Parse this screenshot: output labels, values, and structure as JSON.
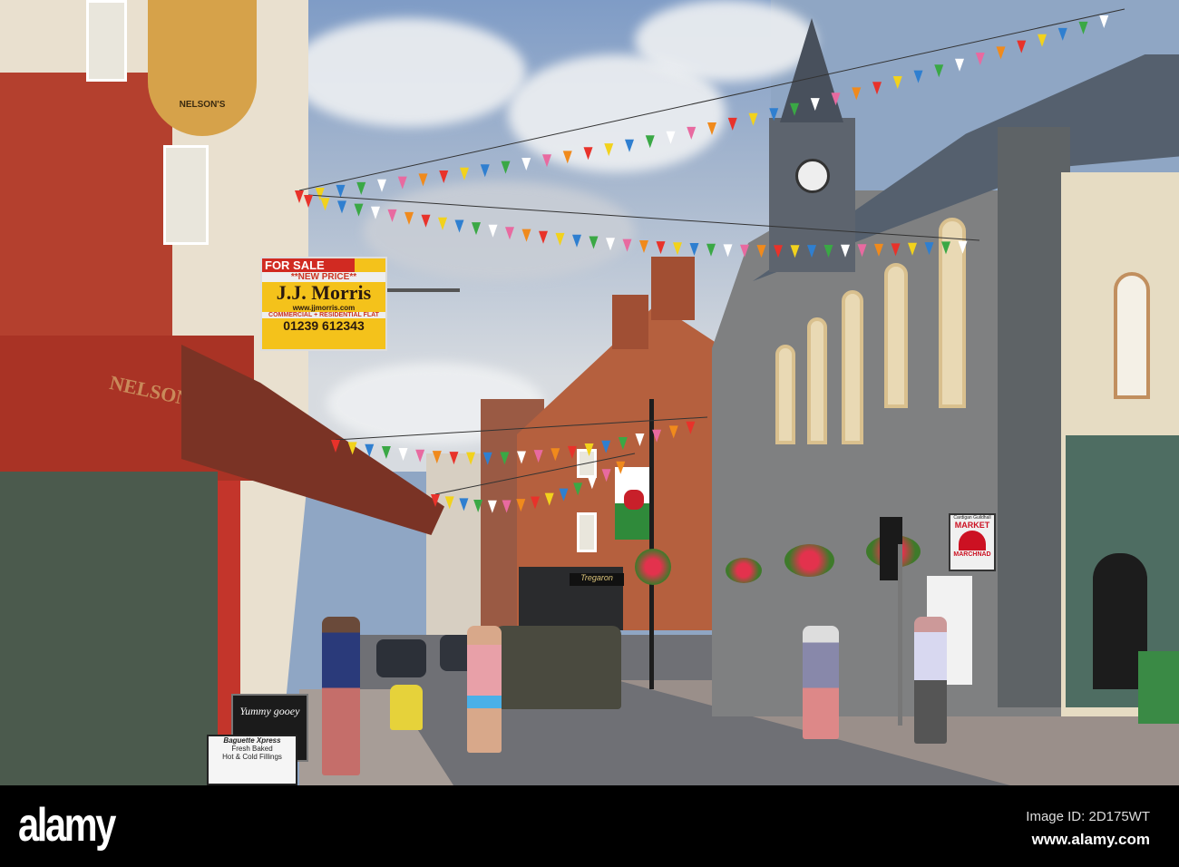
{
  "signs": {
    "for_sale": "FOR SALE",
    "new_price": "**NEW PRICE**",
    "agent": "J.J. Morris",
    "website": "www.jjmorris.com",
    "type": "COMMERCIAL + RESIDENTIAL FLAT",
    "phone": "01239 612343",
    "shop_name": "NELSON'S",
    "hanging_sign": "NELSON'S",
    "market_top": "Cardigan Guildhall",
    "market": "MARKET",
    "marchnad": "MARCHNAD",
    "board_yummy": "Yummy gooey",
    "board_baguette": "Baguette Xpress",
    "board_fresh": "Fresh Baked",
    "board_fillings": "Hot & Cold Fillings",
    "shop_tregaron": "Tregaron"
  },
  "watermark": {
    "logo": "alamy",
    "image_id": "Image ID: 2D175WT",
    "url": "www.alamy.com"
  }
}
